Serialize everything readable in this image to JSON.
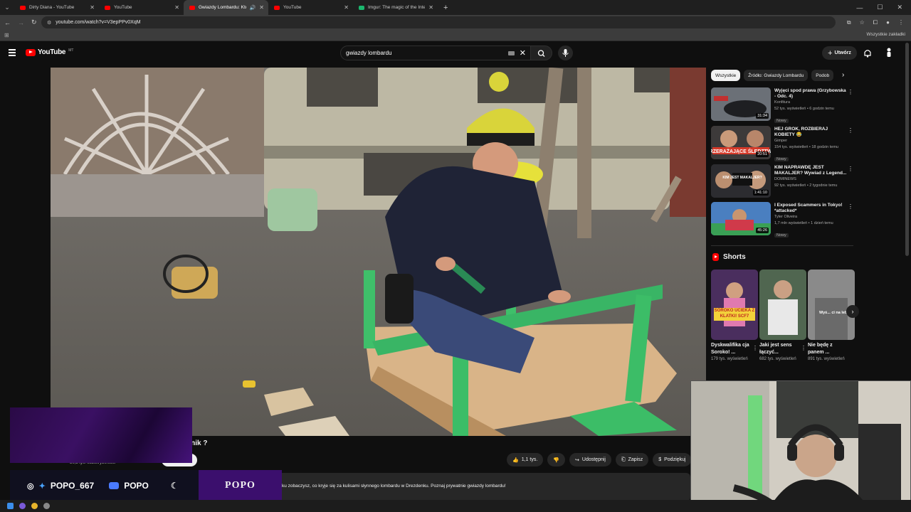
{
  "browser": {
    "tabs": [
      {
        "title": "Dirty Diana - YouTube",
        "active": false
      },
      {
        "title": "YouTube",
        "active": false
      },
      {
        "title": "Gwiazdy Lombardu: Kto zb",
        "active": true
      },
      {
        "title": "YouTube",
        "active": false
      },
      {
        "title": "Imgur: The magic of the Interne",
        "active": false
      }
    ],
    "url": "youtube.com/watch?v=V3epPPv0XqM",
    "bookmarks_all": "Wszystkie zakładki"
  },
  "youtube": {
    "logo_text": "YouTube",
    "country": "MT",
    "search_value": "gwiazdy lombardu",
    "create_label": "Utwórz"
  },
  "video": {
    "title_tail": "nnik ?",
    "subscribers": "30,3 tys. subskrybentów",
    "likes": "1,1 tys.",
    "share": "Udostępnij",
    "save": "Zapisz",
    "thanks": "Podziękuj",
    "description": "ku zobaczysz, co kryje się za kulisami słynnego lombardu w Drezdenku. Poznaj prywatnie gwiazdy lombardu!"
  },
  "chips": [
    "Wszystkie",
    "Źródło: Gwiazdy Lombardu",
    "Podob"
  ],
  "recommendations": [
    {
      "title": "Wyjęci spod prawa (Grzybowska - Odc. 4)",
      "channel": "Konfitura",
      "meta": "52 tys. wyświetleń • 6 godzin temu",
      "badge": "Nowy",
      "duration": "31:34",
      "thumb_color": "#5a5f66"
    },
    {
      "title": "HEJ GROK, ROZBIERAJ KOBIETY 😂",
      "channel": "Gimper",
      "meta": "154 tys. wyświetleń • 18 godzin temu",
      "badge": "Nowy",
      "duration": "20:51",
      "thumb_color": "#7b3f2e"
    },
    {
      "title": "KIM NAPRAWDĘ JEST MAKALJER? Wywiad z Legend...",
      "channel": "DOMINEWS",
      "meta": "92 tys. wyświetleń • 2 tygodnie temu",
      "badge": "",
      "duration": "1:41:10",
      "thumb_color": "#2d2d33"
    },
    {
      "title": "I Exposed Scammers in Tokyo! *attacked*",
      "channel": "Tyler Oliveira",
      "meta": "1,7 mln wyświetleń • 1 dzień temu",
      "badge": "Nowy",
      "duration": "45:26",
      "thumb_color": "#3b6fb0"
    }
  ],
  "thumb_texts": [
    "PRZERAŻAJĄCE ŚLEDZTWO",
    "KIM JEST MAKALJER?"
  ],
  "shorts": {
    "heading": "Shorts",
    "items": [
      {
        "title": "Dyskwalifika cja Soroko! ...",
        "views": "179 tys. wyświetleń",
        "overlay": "SOROKO UCIEKA Z KLATKI! SCF7",
        "color": "#5a3a6a"
      },
      {
        "title": "Jaki jest sens łączyć...",
        "views": "682 tys. wyświetleń",
        "overlay": "",
        "color": "#556b55"
      },
      {
        "title": "Nie będę z panem ...",
        "views": "891 tys. wyświetleń",
        "overlay": "Wyś... ci na leb",
        "color": "#7d7d7d"
      }
    ]
  },
  "stream": {
    "handle": "POPO_667",
    "youtube_name": "POPO",
    "logo_text": "POPO"
  },
  "colors": {
    "accent": "#ff0000",
    "bg": "#0f0f0f",
    "chip": "#272727",
    "purple": "#3b0f6d"
  }
}
